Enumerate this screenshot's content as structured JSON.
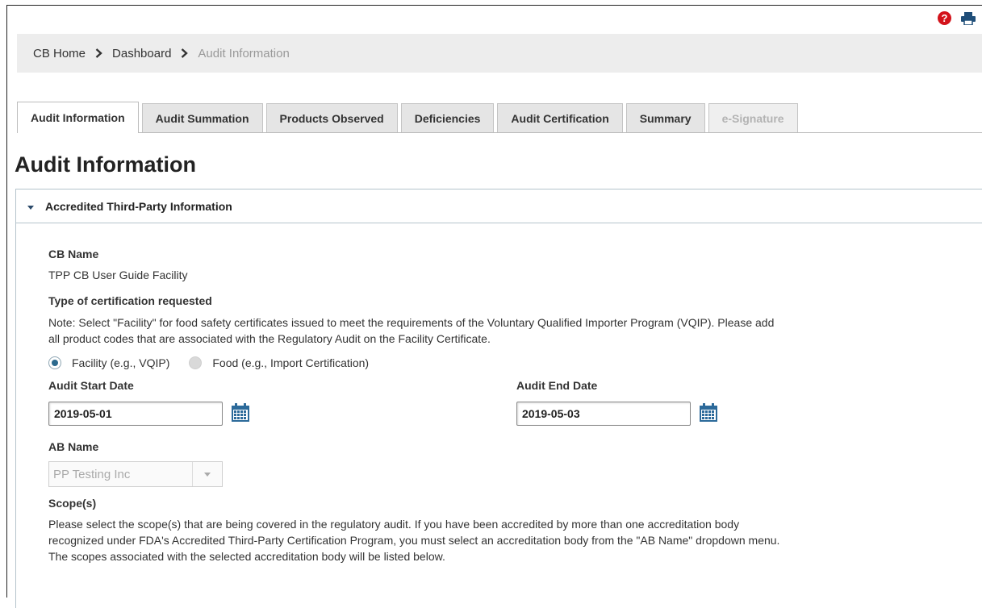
{
  "breadcrumb": {
    "items": [
      "CB Home",
      "Dashboard"
    ],
    "current": "Audit Information"
  },
  "tabs": [
    {
      "label": "Audit Information",
      "state": "active"
    },
    {
      "label": "Audit Summation",
      "state": "normal"
    },
    {
      "label": "Products Observed",
      "state": "normal"
    },
    {
      "label": "Deficiencies",
      "state": "normal"
    },
    {
      "label": "Audit Certification",
      "state": "normal"
    },
    {
      "label": "Summary",
      "state": "normal"
    },
    {
      "label": "e-Signature",
      "state": "disabled"
    }
  ],
  "page": {
    "title": "Audit Information"
  },
  "panel": {
    "title": "Accredited Third-Party Information",
    "expanded": true
  },
  "form": {
    "cb_name_label": "CB Name",
    "cb_name_value": "TPP CB User Guide Facility",
    "cert_type_label": "Type of certification requested",
    "cert_type_note_line1": "Note: Select \"Facility\" for food safety certificates issued to meet the requirements of the Voluntary Qualified Importer Program (VQIP). Please add",
    "cert_type_note_line2": "all product codes that are associated with the Regulatory Audit on the Facility Certificate.",
    "cert_options": [
      {
        "label": "Facility (e.g., VQIP)",
        "checked": true
      },
      {
        "label": "Food (e.g., Import Certification)",
        "checked": false
      }
    ],
    "audit_start_label": "Audit Start Date",
    "audit_start_value": "2019-05-01",
    "audit_end_label": "Audit End Date",
    "audit_end_value": "2019-05-03",
    "ab_name_label": "AB Name",
    "ab_name_value": "PP Testing Inc",
    "scope_label": "Scope(s)",
    "scope_text_line1": "Please select the scope(s) that are being covered in the regulatory audit. If you have been accredited by more than one accreditation body",
    "scope_text_line2": "recognized under FDA's Accredited Third-Party Certification Program, you must select an accreditation body from the \"AB Name\" dropdown menu.",
    "scope_text_line3": "The scopes associated with the selected accreditation body will be listed below."
  },
  "colors": {
    "help_icon": "#d3131b",
    "print_icon": "#1f4e79",
    "calendar_icon": "#2c6a9a",
    "radio_selected": "#2c6a8e"
  },
  "icons": [
    "help-icon",
    "print-icon",
    "chevron-right-icon",
    "caret-down-icon",
    "calendar-icon",
    "dropdown-arrow-icon"
  ]
}
